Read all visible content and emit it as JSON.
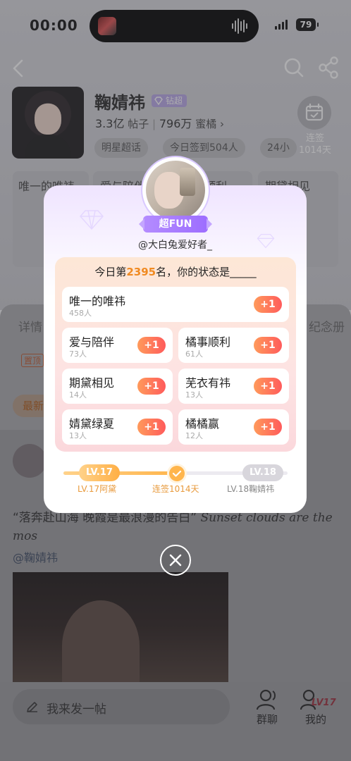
{
  "status_bar": {
    "time": "00:00",
    "battery": "79"
  },
  "topic": {
    "name": "鞠婧祎",
    "badge": "钻超",
    "posts_count": "3.3亿",
    "posts_label": "帖子",
    "fans_count": "796万",
    "fans_label": "蜜橘",
    "tags": [
      "明星超话",
      "今日签到504人",
      "24小"
    ],
    "checkin_label": "连签",
    "checkin_days": "1014天"
  },
  "background_page": {
    "mood_labels": [
      "唯一的唯祎",
      "爱与陪伴",
      "橘事顺利",
      "期黛相见"
    ],
    "tabs_partial": [
      "详情",
      "纪念册"
    ],
    "pinned_label": "置顶",
    "latest_label": "最新",
    "post_text": "“落奔赴山海 晚霞是最浪漫的告白”",
    "post_text_script": "Sunset clouds are the mos",
    "post_mention": "@鞠婧祎",
    "compose_placeholder": "我来发一帖",
    "nav_group_chat": "群聊",
    "nav_mine": "我的",
    "nav_level": "LV17"
  },
  "modal": {
    "badge_label": "超FUN",
    "username": "@大白兔爱好者_",
    "rank_prefix": "今日第",
    "rank_number": "2395",
    "rank_suffix": "名，你的状态是_____",
    "options": [
      {
        "name": "唯一的唯祎",
        "count": "458人",
        "button": "+1"
      },
      {
        "name": "爱与陪伴",
        "count": "73人",
        "button": "+1"
      },
      {
        "name": "橘事顺利",
        "count": "61人",
        "button": "+1"
      },
      {
        "name": "期黛相见",
        "count": "14人",
        "button": "+1"
      },
      {
        "name": "芜衣有祎",
        "count": "13人",
        "button": "+1"
      },
      {
        "name": "婧黛绿夏",
        "count": "13人",
        "button": "+1"
      },
      {
        "name": "橘橘赢",
        "count": "12人",
        "button": "+1"
      }
    ],
    "level_current": "LV.17",
    "level_next": "LV.18",
    "level_current_label": "LV.17阿黛",
    "checkin_streak_label": "连签1014天",
    "level_next_label": "LV.18鞠婧祎",
    "progress_fraction": 0.5
  },
  "colors": {
    "accent_orange": "#f08a21",
    "plus_button": "#ff6a55",
    "fun_badge": "#a878ff"
  }
}
